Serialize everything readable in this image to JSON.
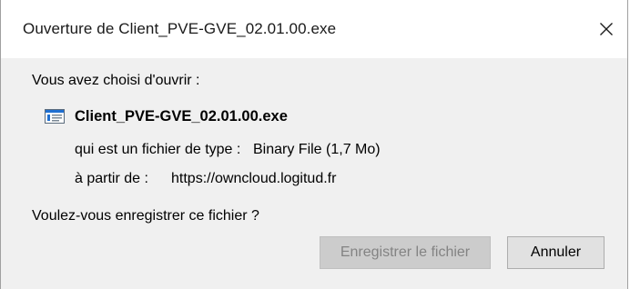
{
  "window": {
    "title": "Ouverture de Client_PVE-GVE_02.01.00.exe",
    "close_icon": "close-icon"
  },
  "dialog": {
    "intro": "Vous avez choisi d'ouvrir :",
    "file_icon": "executable-file-icon",
    "filename": "Client_PVE-GVE_02.01.00.exe",
    "type_label": "qui est un fichier de type :",
    "type_value": "Binary File (1,7 Mo)",
    "source_label": "à partir de :",
    "source_value": "https://owncloud.logitud.fr",
    "question": "Voulez-vous enregistrer ce fichier ?"
  },
  "buttons": {
    "save_label": "Enregistrer le fichier",
    "cancel_label": "Annuler"
  },
  "colors": {
    "content_background": "#f0f0f0",
    "disabled_text": "#838383",
    "icon_blue": "#1f6fd1"
  }
}
